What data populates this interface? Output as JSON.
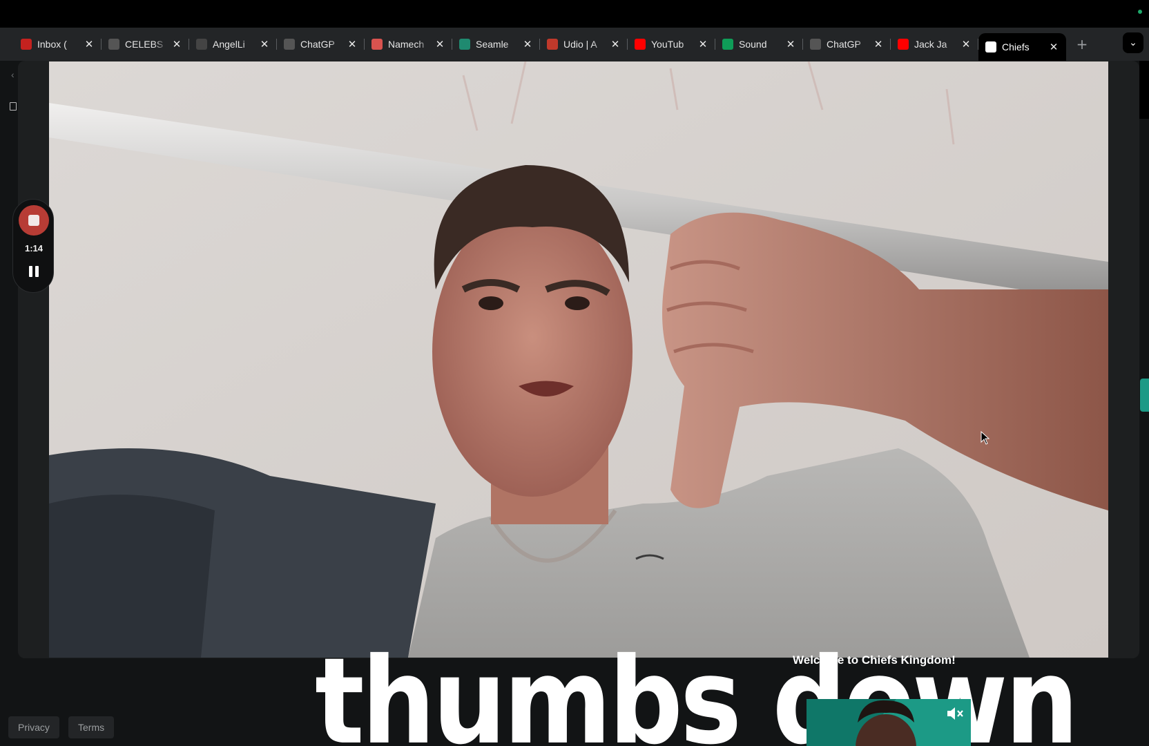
{
  "browser": {
    "tabs": [
      {
        "label": "Inbox (",
        "icon": "gmail-icon",
        "color": "#c5221f"
      },
      {
        "label": "CELEBS",
        "icon": "celebs-icon",
        "color": "#555555"
      },
      {
        "label": "AngelLi",
        "icon": "angellist-icon",
        "color": "#444444"
      },
      {
        "label": "ChatGP",
        "icon": "chatgpt-icon",
        "color": "#555555"
      },
      {
        "label": "Namech",
        "icon": "namecheap-icon",
        "color": "#d9534f"
      },
      {
        "label": "Seamle",
        "icon": "seamless-icon",
        "color": "#1f8a70"
      },
      {
        "label": "Udio | A",
        "icon": "udio-icon",
        "color": "#c0392b"
      },
      {
        "label": "YouTub",
        "icon": "youtube-icon",
        "color": "#ff0000"
      },
      {
        "label": "Sound",
        "icon": "sheets-icon",
        "color": "#0f9d58"
      },
      {
        "label": "ChatGP",
        "icon": "chatgpt-icon",
        "color": "#555555"
      },
      {
        "label": "Jack Ja",
        "icon": "youtube-icon",
        "color": "#ff0000"
      },
      {
        "label": "Chiefs",
        "icon": "page-icon",
        "color": "#ffffff",
        "active": true
      }
    ],
    "new_tab_symbol": "+",
    "tab_menu_symbol": "⌄"
  },
  "recorder": {
    "time": "1:14",
    "accent": "#b73c35"
  },
  "page": {
    "welcome": "Welcome to Chiefs Kingdom!",
    "caption": "thumbs down",
    "promo_color": "#1c9a86",
    "footer": {
      "privacy": "Privacy",
      "terms": "Terms"
    }
  }
}
